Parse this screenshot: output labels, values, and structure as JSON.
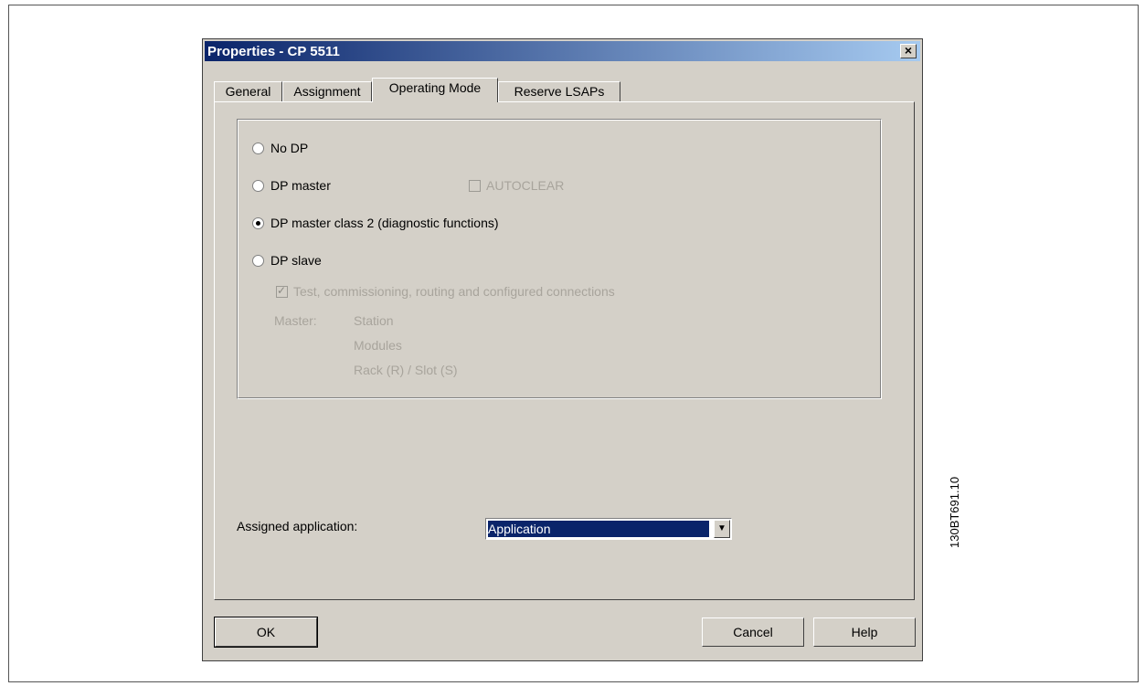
{
  "dialog": {
    "title": "Properties - CP 5511",
    "close_label": "×"
  },
  "tabs": [
    {
      "label": "General"
    },
    {
      "label": "Assignment"
    },
    {
      "label": "Operating Mode"
    },
    {
      "label": "Reserve LSAPs"
    }
  ],
  "operating_mode": {
    "options": [
      {
        "label": "No DP",
        "selected": false
      },
      {
        "label": "DP master",
        "selected": false
      },
      {
        "label": "DP master class 2 (diagnostic functions)",
        "selected": true
      },
      {
        "label": "DP slave",
        "selected": false
      }
    ],
    "autoclear_label": "AUTOCLEAR",
    "test_label": "Test, commissioning, routing and configured connections",
    "master_label": "Master:",
    "station_label": "Station",
    "modules_label": "Modules",
    "rack_slot_label": "Rack (R) / Slot (S)"
  },
  "assigned_application": {
    "label": "Assigned application:",
    "value": "Application"
  },
  "buttons": {
    "ok": "OK",
    "cancel": "Cancel",
    "help": "Help"
  },
  "figure_code": "130BT691.10"
}
